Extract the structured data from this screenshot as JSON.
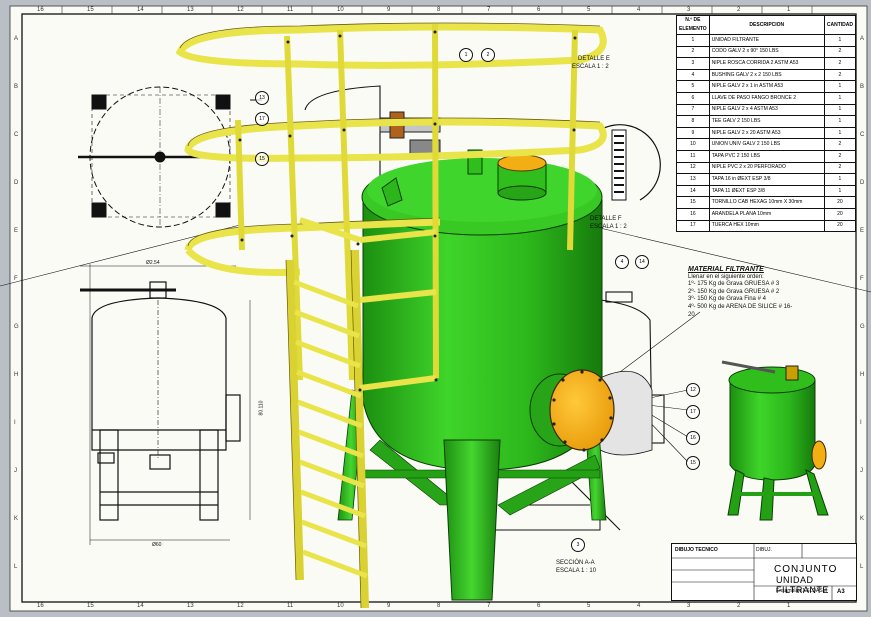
{
  "bom": {
    "headers": [
      "N.º DE ELEMENTO",
      "DESCRIPCION",
      "CANTIDAD"
    ],
    "rows": [
      [
        "1",
        "UNIDAD FILTRANTE",
        "1"
      ],
      [
        "2",
        "CODO GALV 2 x 90° 150 LBS",
        "2"
      ],
      [
        "3",
        "NIPLE ROSCA CORRIDA 2 ASTM A53",
        "2"
      ],
      [
        "4",
        "BUSHING GALV 2 x 2 150 LBS",
        "2"
      ],
      [
        "5",
        "NIPLE GALV 2 x 1 in ASTM A53",
        "1"
      ],
      [
        "6",
        "LLAVE DE PASO FANGO BRONCE 2",
        "1"
      ],
      [
        "7",
        "NIPLE GALV 2 x 4 ASTM A53",
        "1"
      ],
      [
        "8",
        "TEE GALV 2 150 LBS",
        "1"
      ],
      [
        "9",
        "NIPLE GALV 2 x 20 ASTM A53",
        "1"
      ],
      [
        "10",
        "UNION UNIV GALV 2 150 LBS",
        "2"
      ],
      [
        "11",
        "TAPA PVC 2 150 LBS",
        "2"
      ],
      [
        "12",
        "NIPLE PVC 2 x 20 PERFORADO",
        "2"
      ],
      [
        "13",
        "TAPA 16 in ØEXT ESP 3/8",
        "1"
      ],
      [
        "14",
        "TAPA 11 ØEXT ESP 3/8",
        "1"
      ],
      [
        "15",
        "TORNILLO CAB HEXAG 10mm X 30mm",
        "20"
      ],
      [
        "16",
        "ARANDELA PLANA 10mm",
        "20"
      ],
      [
        "17",
        "TUERCA HEX 10mm",
        "20"
      ]
    ]
  },
  "filter_note": {
    "heading": "MATERIAL FILTRANTE",
    "intro": "Llenar en el siguiente orden:",
    "lines": [
      "1º- 175 Kg de Grava GRUESA # 3",
      "2º- 150 Kg de Grava GRUESA # 2",
      "3º- 150 Kg de Grava Fina # 4",
      "4º- 500 Kg de ARENA DE SILICE # 16-20"
    ]
  },
  "views": {
    "detail_label": "DETALLE F",
    "detail_scale": "ESCALA 1 : 2",
    "section_label": "SECCIÓN A-A",
    "section_scale": "ESCALA 1 : 10",
    "top_label": "DETALLE E",
    "top_scale": "ESCALA 1 : 2",
    "dim_width": "Ø60",
    "dim_height": "80.110",
    "dim_top": "Ø2.54"
  },
  "callouts": [
    "13",
    "17",
    "15",
    "1",
    "2",
    "4",
    "14",
    "12",
    "17",
    "16",
    "15",
    "3"
  ],
  "zones": {
    "top": [
      "16",
      "15",
      "14",
      "13",
      "12",
      "11",
      "10",
      "9",
      "8",
      "7",
      "6",
      "5",
      "4",
      "3",
      "2",
      "1"
    ],
    "side": [
      "A",
      "B",
      "C",
      "D",
      "E",
      "F",
      "G",
      "H",
      "I",
      "J",
      "K",
      "L"
    ]
  },
  "title_block": {
    "title_line1": "CONJUNTO",
    "title_line2": "UNIDAD FILTRANTE",
    "file_name": "Ensamblaje1.SLDASM",
    "company": "DIBUJO TECNICO",
    "drawing_label": "DIBUJ.",
    "sheet": "A3"
  },
  "colors": {
    "tank": "#2fbe1c",
    "cage": "#e8e44a",
    "cover": "#f2ae12",
    "paper": "#fbfbf6"
  }
}
